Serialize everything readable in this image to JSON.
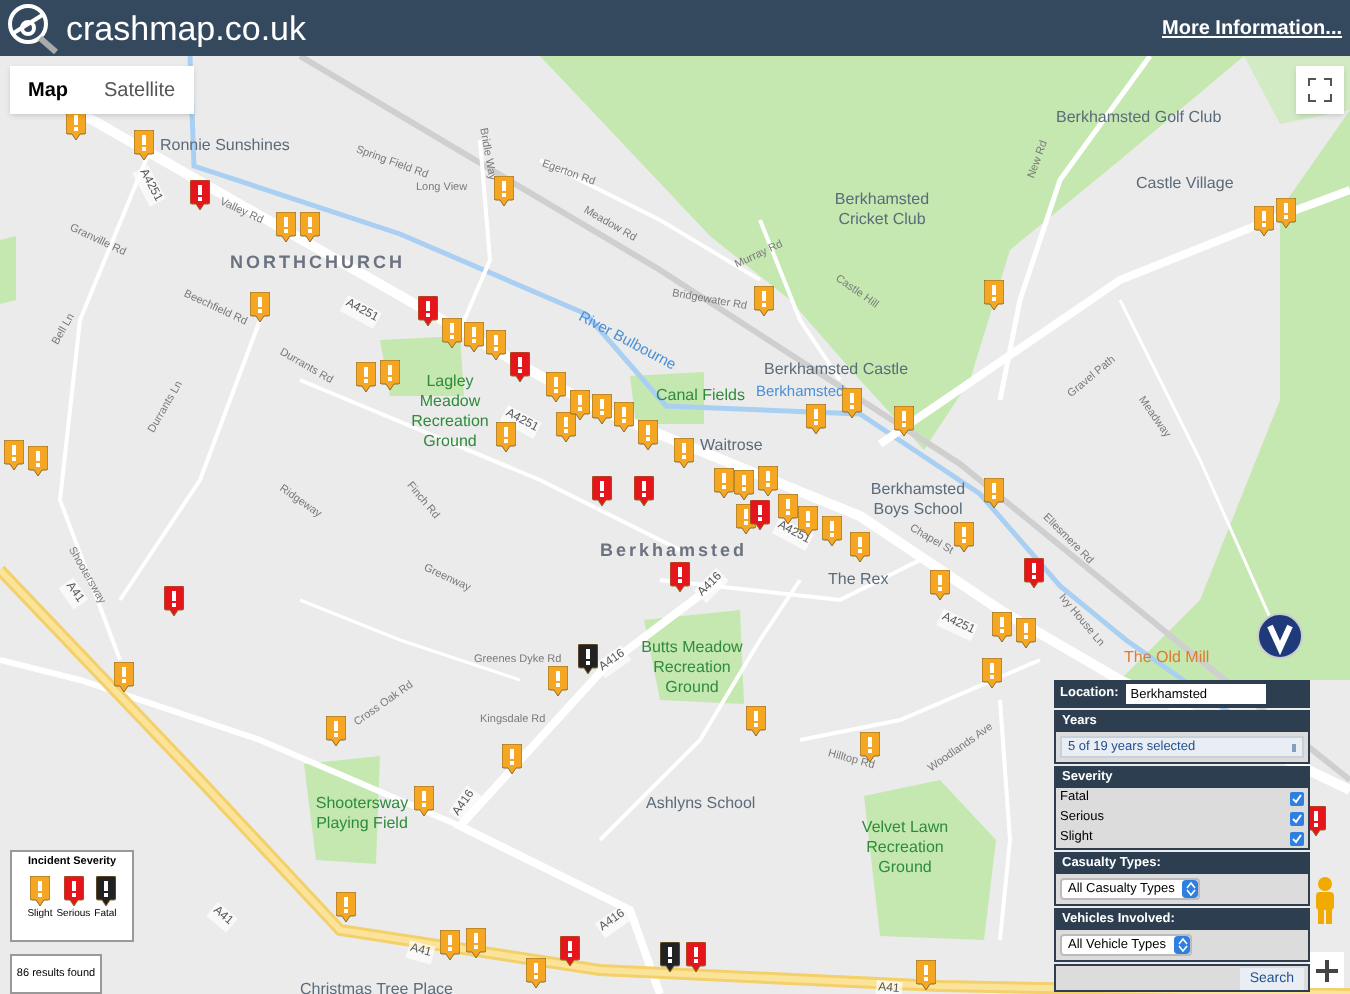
{
  "header": {
    "site_name": "crashmap.co.uk",
    "link": "More Information..."
  },
  "map_type_tabs": [
    {
      "label": "Map",
      "selected": true
    },
    {
      "label": "Satellite",
      "selected": false
    }
  ],
  "map_labels": [
    {
      "kind": "place",
      "text": "NORTHCHURCH"
    },
    {
      "kind": "place",
      "text": "Berkhamsted"
    },
    {
      "kind": "poi",
      "text": "Ronnie Sunshines"
    },
    {
      "kind": "poi",
      "text": "Berkhamsted Golf Club"
    },
    {
      "kind": "poi",
      "text": "Berkhamsted Cricket Club"
    },
    {
      "kind": "poi",
      "text": "Castle Village"
    },
    {
      "kind": "poi",
      "text": "Berkhamsted Castle"
    },
    {
      "kind": "park",
      "text": "Canal Fields"
    },
    {
      "kind": "water",
      "text": "Berkhamsted"
    },
    {
      "kind": "poi",
      "text": "Waitrose"
    },
    {
      "kind": "poi",
      "text": "Berkhamsted Boys School"
    },
    {
      "kind": "poi",
      "text": "The Rex"
    },
    {
      "kind": "shop",
      "text": "The Old Mill"
    },
    {
      "kind": "park",
      "text": "Lagley Meadow Recreation Ground"
    },
    {
      "kind": "park",
      "text": "Butts Meadow Recreation Ground"
    },
    {
      "kind": "park",
      "text": "Shootersway Playing Field"
    },
    {
      "kind": "poi",
      "text": "Ashlyns School"
    },
    {
      "kind": "park",
      "text": "Velvet Lawn Recreation Ground"
    },
    {
      "kind": "poi",
      "text": "Christmas Tree Place"
    },
    {
      "kind": "water",
      "text": "River Bulbourne"
    },
    {
      "kind": "road",
      "text": "A4251"
    },
    {
      "kind": "road",
      "text": "A4251"
    },
    {
      "kind": "road",
      "text": "A4251"
    },
    {
      "kind": "road",
      "text": "A4251"
    },
    {
      "kind": "road",
      "text": "A4251"
    },
    {
      "kind": "road",
      "text": "A416"
    },
    {
      "kind": "road",
      "text": "A416"
    },
    {
      "kind": "road",
      "text": "A416"
    },
    {
      "kind": "road",
      "text": "A416"
    },
    {
      "kind": "road",
      "text": "A41"
    },
    {
      "kind": "road",
      "text": "A41"
    },
    {
      "kind": "road",
      "text": "A41"
    },
    {
      "kind": "road",
      "text": "A41"
    },
    {
      "kind": "street",
      "text": "Valley Rd"
    },
    {
      "kind": "street",
      "text": "Gravel Path"
    },
    {
      "kind": "street",
      "text": "New Rd"
    },
    {
      "kind": "street",
      "text": "Castle Hill"
    },
    {
      "kind": "street",
      "text": "Murray Rd"
    },
    {
      "kind": "street",
      "text": "Bridgewater Rd"
    },
    {
      "kind": "street",
      "text": "Durrants Rd"
    },
    {
      "kind": "street",
      "text": "Greenes Dyke Rd"
    },
    {
      "kind": "street",
      "text": "Kingsdale Rd"
    },
    {
      "kind": "street",
      "text": "Shootersway"
    },
    {
      "kind": "street",
      "text": "Bell Ln"
    },
    {
      "kind": "street",
      "text": "Durrants Ln"
    },
    {
      "kind": "street",
      "text": "Beechfield Rd"
    },
    {
      "kind": "street",
      "text": "Granville Rd"
    },
    {
      "kind": "street",
      "text": "Egerton Rd"
    },
    {
      "kind": "street",
      "text": "Meadow Rd"
    },
    {
      "kind": "street",
      "text": "Spring Field Rd"
    },
    {
      "kind": "street",
      "text": "Long View"
    },
    {
      "kind": "street",
      "text": "Bridle Way"
    },
    {
      "kind": "street",
      "text": "Finch Rd"
    },
    {
      "kind": "street",
      "text": "Greenway"
    },
    {
      "kind": "street",
      "text": "Ridgeway"
    },
    {
      "kind": "street",
      "text": "Ellesmere Rd"
    },
    {
      "kind": "street",
      "text": "Chapel St"
    },
    {
      "kind": "street",
      "text": "Ivy House Ln"
    },
    {
      "kind": "street",
      "text": "Hilltop Rd"
    },
    {
      "kind": "street",
      "text": "Woodlands Ave"
    },
    {
      "kind": "street",
      "text": "Meadway"
    },
    {
      "kind": "street",
      "text": "Cross Oak Rd"
    }
  ],
  "markers": [
    {
      "kind": "slight"
    },
    {
      "kind": "slight"
    },
    {
      "kind": "slight"
    },
    {
      "kind": "slight"
    },
    {
      "kind": "slight"
    },
    {
      "kind": "slight"
    },
    {
      "kind": "slight"
    },
    {
      "kind": "slight"
    },
    {
      "kind": "slight"
    },
    {
      "kind": "slight"
    },
    {
      "kind": "slight"
    },
    {
      "kind": "slight"
    },
    {
      "kind": "slight"
    },
    {
      "kind": "slight"
    },
    {
      "kind": "slight"
    },
    {
      "kind": "slight"
    },
    {
      "kind": "slight"
    },
    {
      "kind": "slight"
    },
    {
      "kind": "slight"
    },
    {
      "kind": "slight"
    },
    {
      "kind": "slight"
    },
    {
      "kind": "slight"
    },
    {
      "kind": "slight"
    },
    {
      "kind": "slight"
    },
    {
      "kind": "slight"
    },
    {
      "kind": "slight"
    },
    {
      "kind": "slight"
    },
    {
      "kind": "slight"
    },
    {
      "kind": "slight"
    },
    {
      "kind": "slight"
    },
    {
      "kind": "slight"
    },
    {
      "kind": "slight"
    },
    {
      "kind": "slight"
    },
    {
      "kind": "slight"
    },
    {
      "kind": "slight"
    },
    {
      "kind": "slight"
    },
    {
      "kind": "slight"
    },
    {
      "kind": "slight"
    },
    {
      "kind": "slight"
    },
    {
      "kind": "slight"
    },
    {
      "kind": "slight"
    },
    {
      "kind": "slight"
    },
    {
      "kind": "slight"
    },
    {
      "kind": "slight"
    },
    {
      "kind": "slight"
    },
    {
      "kind": "slight"
    },
    {
      "kind": "slight"
    },
    {
      "kind": "slight"
    },
    {
      "kind": "slight"
    },
    {
      "kind": "slight"
    },
    {
      "kind": "slight"
    },
    {
      "kind": "slight"
    },
    {
      "kind": "slight"
    },
    {
      "kind": "slight"
    },
    {
      "kind": "serious"
    },
    {
      "kind": "serious"
    },
    {
      "kind": "serious"
    },
    {
      "kind": "serious"
    },
    {
      "kind": "serious"
    },
    {
      "kind": "serious"
    },
    {
      "kind": "serious"
    },
    {
      "kind": "serious"
    },
    {
      "kind": "serious"
    },
    {
      "kind": "serious"
    },
    {
      "kind": "serious"
    },
    {
      "kind": "serious"
    },
    {
      "kind": "fatal"
    },
    {
      "kind": "fatal"
    }
  ],
  "filters": {
    "location": {
      "label": "Location:",
      "value": "Berkhamsted"
    },
    "years": {
      "heading": "Years",
      "value": "5 of 19 years selected"
    },
    "severity": {
      "heading": "Severity",
      "options": [
        {
          "label": "Fatal",
          "checked": true
        },
        {
          "label": "Serious",
          "checked": true
        },
        {
          "label": "Slight",
          "checked": true
        }
      ]
    },
    "casualty_types": {
      "heading": "Casualty Types:",
      "value": "All Casualty Types"
    },
    "vehicles": {
      "heading": "Vehicles Involved:",
      "value": "All Vehicle Types"
    },
    "search_button": "Search"
  },
  "legend": {
    "title": "Incident Severity",
    "items": [
      {
        "kind": "slight",
        "label": "Slight"
      },
      {
        "kind": "serious",
        "label": "Serious"
      },
      {
        "kind": "fatal",
        "label": "Fatal"
      }
    ]
  },
  "results": "86 results found"
}
